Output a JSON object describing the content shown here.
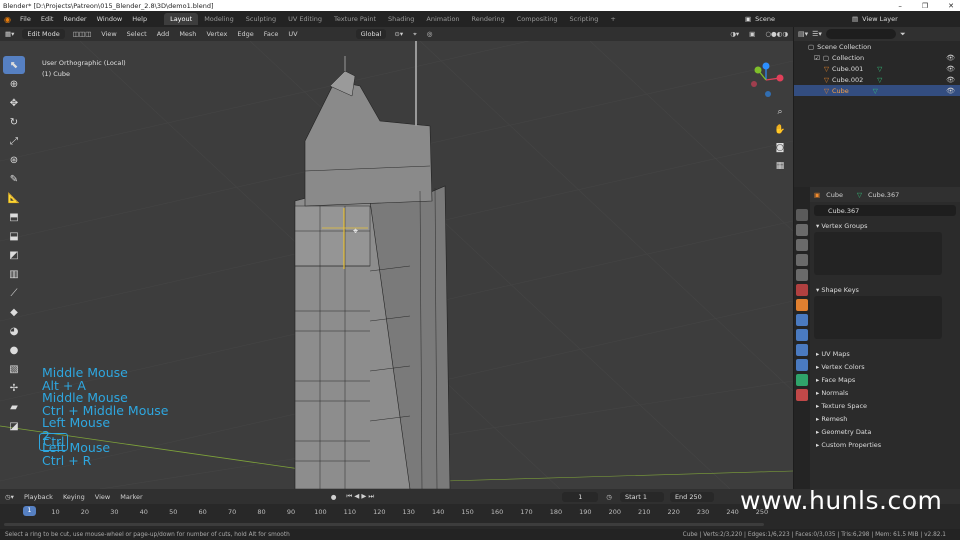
{
  "window": {
    "title": "Blender* [D:\\Projects\\Patreon\\015_Blender_2.8\\3D\\demo1.blend]",
    "min": "–",
    "max": "❐",
    "close": "✕"
  },
  "menus": [
    "File",
    "Edit",
    "Render",
    "Window",
    "Help"
  ],
  "workspaces": [
    "Layout",
    "Modeling",
    "Sculpting",
    "UV Editing",
    "Texture Paint",
    "Shading",
    "Animation",
    "Rendering",
    "Compositing",
    "Scripting"
  ],
  "active_workspace": "Layout",
  "scene": "Scene",
  "view_layer": "View Layer",
  "viewport_header": {
    "mode": "Edit Mode",
    "menus": [
      "View",
      "Select",
      "Add",
      "Mesh",
      "Vertex",
      "Edge",
      "Face",
      "UV"
    ],
    "orientation": "Global",
    "options": "Options"
  },
  "viewport": {
    "view_name": "User Orthographic (Local)",
    "object_name": "(1) Cube",
    "gizmo": {
      "x": "X",
      "y": "Y",
      "z": "Z"
    }
  },
  "key_overlay": [
    "Middle Mouse",
    "Alt + A",
    "Middle Mouse",
    "Ctrl + Middle Mouse",
    "Left Mouse",
    "2",
    "Left Mouse",
    "Ctrl + R"
  ],
  "key_badge": "Ctrl",
  "outliner": {
    "rows": [
      {
        "label": "Scene Collection"
      },
      {
        "label": "Collection"
      },
      {
        "label": "Cube.001"
      },
      {
        "label": "Cube.002"
      },
      {
        "label": "Cube",
        "selected": true
      }
    ]
  },
  "properties": {
    "object": "Cube",
    "mesh": "Cube.367",
    "mesh_field": "Cube.367",
    "panels": [
      "Vertex Groups",
      "Shape Keys"
    ],
    "collapsed": [
      "UV Maps",
      "Vertex Colors",
      "Face Maps",
      "Normals",
      "Texture Space",
      "Remesh",
      "Geometry Data",
      "Custom Properties"
    ]
  },
  "timeline": {
    "menus": [
      "Playback",
      "Keying",
      "View",
      "Marker"
    ],
    "current_frame": "1",
    "start_label": "Start",
    "start_value": "1",
    "end_label": "End",
    "end_value": "250",
    "ticks": [
      "1",
      "10",
      "20",
      "30",
      "40",
      "50",
      "60",
      "70",
      "80",
      "90",
      "100",
      "110",
      "120",
      "130",
      "140",
      "150",
      "160",
      "170",
      "180",
      "190",
      "200",
      "210",
      "220",
      "230",
      "240",
      "250"
    ]
  },
  "status": {
    "hint": "Select a ring to be cut, use mouse-wheel or page-up/down for number of cuts, hold Alt for smooth",
    "stats": "Cube | Verts:2/3,220 | Edges:1/6,223 | Faces:0/3,035 | Tris:6,298 | Mem: 61.5 MiB | v2.82.1"
  },
  "watermark": "www.hunls.com",
  "colors": {
    "accent": "#5680c2",
    "overlay": "#2ea7e0",
    "selected_row": "#334d80"
  }
}
